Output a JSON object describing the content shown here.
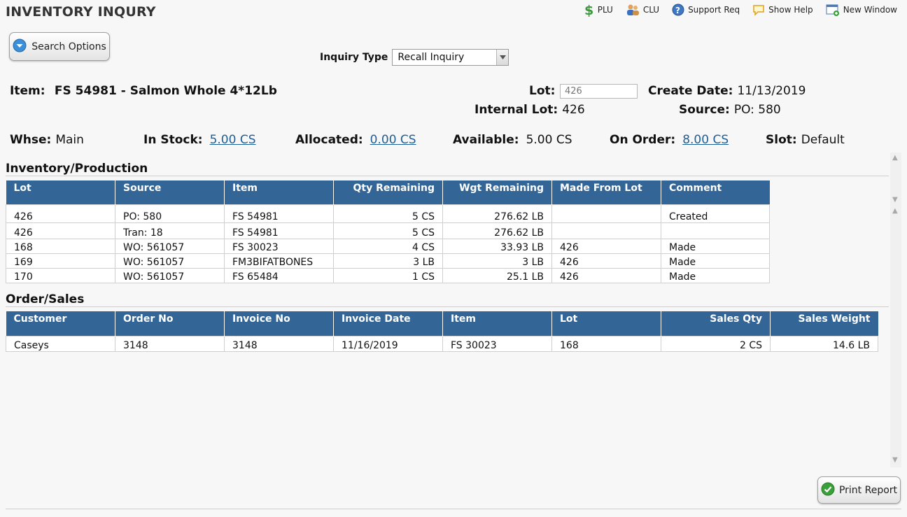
{
  "page": {
    "title": "INVENTORY INQURY"
  },
  "toolbar": {
    "plu": "PLU",
    "clu": "CLU",
    "support": "Support Req",
    "help": "Show Help",
    "new_window": "New Window"
  },
  "search": {
    "label": "Search Options"
  },
  "inquiry": {
    "label": "Inquiry Type",
    "selected": "Recall Inquiry"
  },
  "item": {
    "label": "Item:",
    "value": "FS 54981 - Salmon Whole 4*12Lb"
  },
  "lot": {
    "label": "Lot:",
    "value": "426"
  },
  "create_date": {
    "label": "Create Date:",
    "value": "11/13/2019"
  },
  "internal_lot": {
    "label": "Internal Lot:",
    "value": "426"
  },
  "source": {
    "label": "Source:",
    "value": "PO: 580"
  },
  "stock": {
    "whse_label": "Whse:",
    "whse": "Main",
    "in_stock_label": "In Stock:",
    "in_stock": "5.00 CS",
    "allocated_label": "Allocated:",
    "allocated": "0.00 CS",
    "available_label": "Available:",
    "available": "5.00 CS",
    "on_order_label": "On Order:",
    "on_order": "8.00 CS",
    "slot_label": "Slot:",
    "slot": "Default"
  },
  "inventory": {
    "title": "Inventory/Production",
    "columns": [
      "Lot",
      "Source",
      "Item",
      "Qty Remaining",
      "Wgt Remaining",
      "Made From Lot",
      "Comment"
    ],
    "rows": [
      [
        "426",
        "PO: 580",
        "FS 54981",
        "5 CS",
        "276.62 LB",
        "",
        "Created"
      ],
      [
        "426",
        "Tran: 18",
        "FS 54981",
        "5 CS",
        "276.62 LB",
        "",
        ""
      ],
      [
        "168",
        "WO: 561057",
        "FS 30023",
        "4 CS",
        "33.93 LB",
        "426",
        "Made"
      ],
      [
        "169",
        "WO: 561057",
        "FM3BIFATBONES",
        "3 LB",
        "3 LB",
        "426",
        "Made"
      ],
      [
        "170",
        "WO: 561057",
        "FS 65484",
        "1 CS",
        "25.1 LB",
        "426",
        "Made"
      ]
    ]
  },
  "orders": {
    "title": "Order/Sales",
    "columns": [
      "Customer",
      "Order No",
      "Invoice No",
      "Invoice Date",
      "Item",
      "Lot",
      "Sales Qty",
      "Sales Weight"
    ],
    "rows": [
      [
        "Caseys",
        "3148",
        "3148",
        "11/16/2019",
        "FS 30023",
        "168",
        "2 CS",
        "14.6 LB"
      ]
    ]
  },
  "print": {
    "label": "Print Report"
  },
  "colors": {
    "header": "#336597",
    "link": "#1f5f97"
  }
}
